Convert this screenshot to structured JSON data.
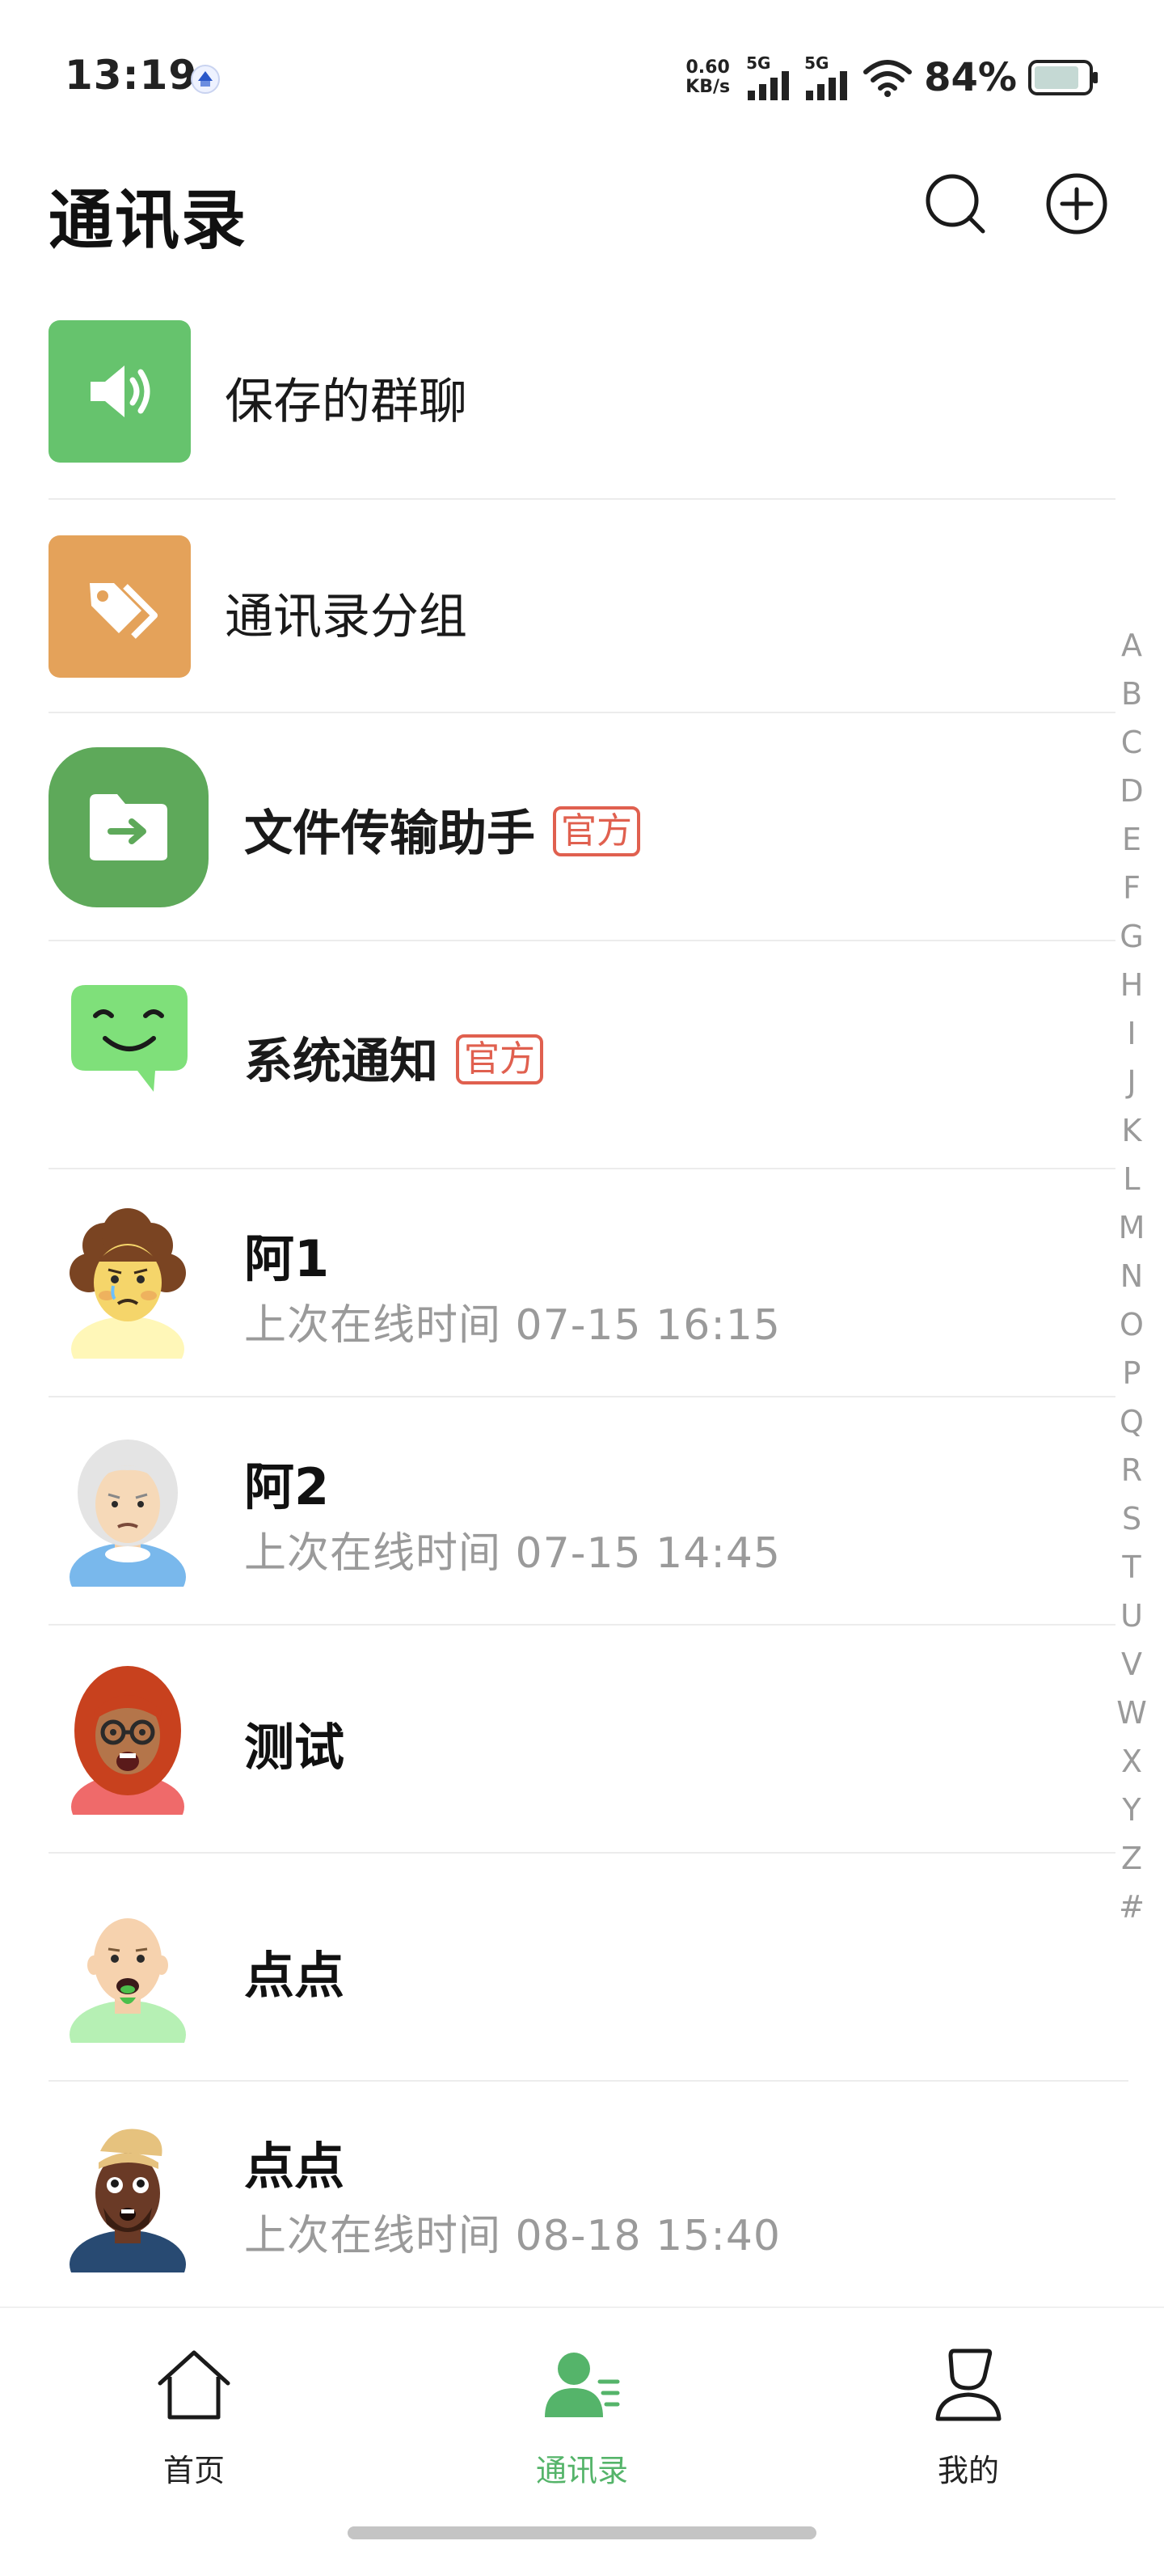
{
  "status_bar": {
    "time": "13:19",
    "net_speed_value": "0.60",
    "net_speed_unit": "KB/s",
    "sim1_label": "5G",
    "sim2_label": "5G",
    "battery_percent": "84%",
    "icons": [
      "app-badge-icon",
      "signal-icon",
      "wifi-icon",
      "battery-icon"
    ]
  },
  "header": {
    "title": "通讯录",
    "search_icon": "search-icon",
    "add_icon": "add-circle-icon"
  },
  "contacts": {
    "official_tag": "官方",
    "saved_groups": {
      "label": "保存的群聊",
      "icon": "speaker-icon",
      "color": "#66c36d"
    },
    "contact_groups": {
      "label": "通讯录分组",
      "icon": "tag-icon",
      "color": "#e4a25a"
    },
    "file_helper": {
      "label": "文件传输助手",
      "icon": "folder-transfer-icon",
      "color": "#5ea95a"
    },
    "system_notice": {
      "label": "系统通知",
      "icon": "smile-chat-icon",
      "color": "#7fe07a"
    },
    "people": [
      {
        "name": "阿1",
        "last_online": "上次在线时间 07-15 16:15"
      },
      {
        "name": "阿2",
        "last_online": "上次在线时间 07-15 14:45"
      },
      {
        "name": "测试",
        "last_online": ""
      },
      {
        "name": "点点",
        "last_online": ""
      },
      {
        "name": "点点",
        "last_online": "上次在线时间 08-18 15:40"
      }
    ]
  },
  "alphabet_index": [
    "A",
    "B",
    "C",
    "D",
    "E",
    "F",
    "G",
    "H",
    "I",
    "J",
    "K",
    "L",
    "M",
    "N",
    "O",
    "P",
    "Q",
    "R",
    "S",
    "T",
    "U",
    "V",
    "W",
    "X",
    "Y",
    "Z",
    "#"
  ],
  "bottom_nav": {
    "home": "首页",
    "contacts": "通讯录",
    "mine": "我的",
    "active": "contacts",
    "accent_color": "#55b46a"
  }
}
